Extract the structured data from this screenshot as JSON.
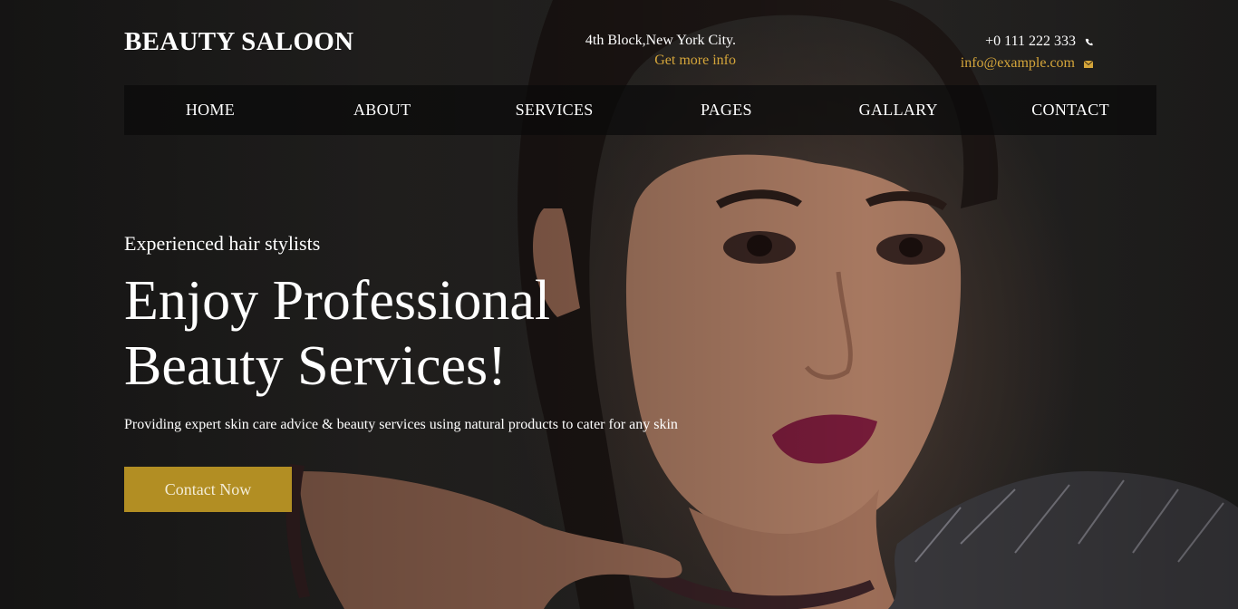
{
  "header": {
    "logo": "BEAUTY SALOON",
    "address": "4th Block,New York City.",
    "more_info_link": "Get more info",
    "phone": "+0 111 222 333",
    "email": "info@example.com"
  },
  "nav": {
    "items": [
      "HOME",
      "ABOUT",
      "SERVICES",
      "PAGES",
      "GALLARY",
      "CONTACT"
    ]
  },
  "hero": {
    "kicker": "Experienced hair stylists",
    "headline_line1": "Enjoy Professional",
    "headline_line2": "Beauty Services!",
    "tagline": "Providing expert skin care advice & beauty services using natural products to cater for any skin",
    "cta_label": "Contact Now"
  },
  "colors": {
    "accent": "#d4a53a",
    "button": "#b28e23",
    "nav_background": "#0a0a0a"
  },
  "icons": {
    "phone": "phone-icon",
    "email": "envelope-icon"
  }
}
